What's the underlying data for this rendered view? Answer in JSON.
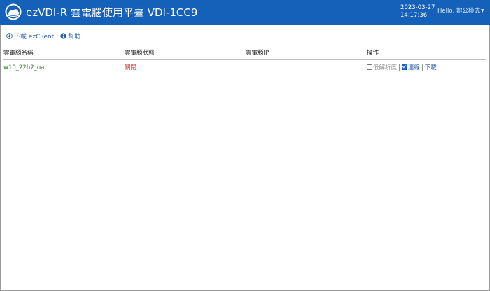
{
  "header": {
    "title": "ezVDI-R 雲電腦使用平臺 VDI-1CC9",
    "date": "2023-03-27",
    "time": "14:17:36",
    "user_menu": "Hello, 辦公模式",
    "logo_icon": "cloud-logo-icon",
    "colors": {
      "bar": "#1560b8",
      "text": "#ffffff"
    }
  },
  "toolbar": {
    "download_label": "下載 ezClient",
    "download_icon": "download-circle-icon",
    "help_label": "幫助",
    "help_icon": "info-circle-icon"
  },
  "table": {
    "columns": [
      "雲電腦名稱",
      "雲電腦狀態",
      "雲電腦IP",
      "操作"
    ],
    "rows": [
      {
        "name": "w10_22h2_oa",
        "status": "關閉",
        "ip": "",
        "ops": {
          "low_res_label": "低解析度",
          "low_res_checked": false,
          "connect_label": "連線",
          "connect_checked": true,
          "download_label": "下載",
          "separator": "|"
        }
      }
    ],
    "colors": {
      "name": "#2d7f2d",
      "status": "#d62a2a",
      "link": "#2a62a8"
    }
  }
}
